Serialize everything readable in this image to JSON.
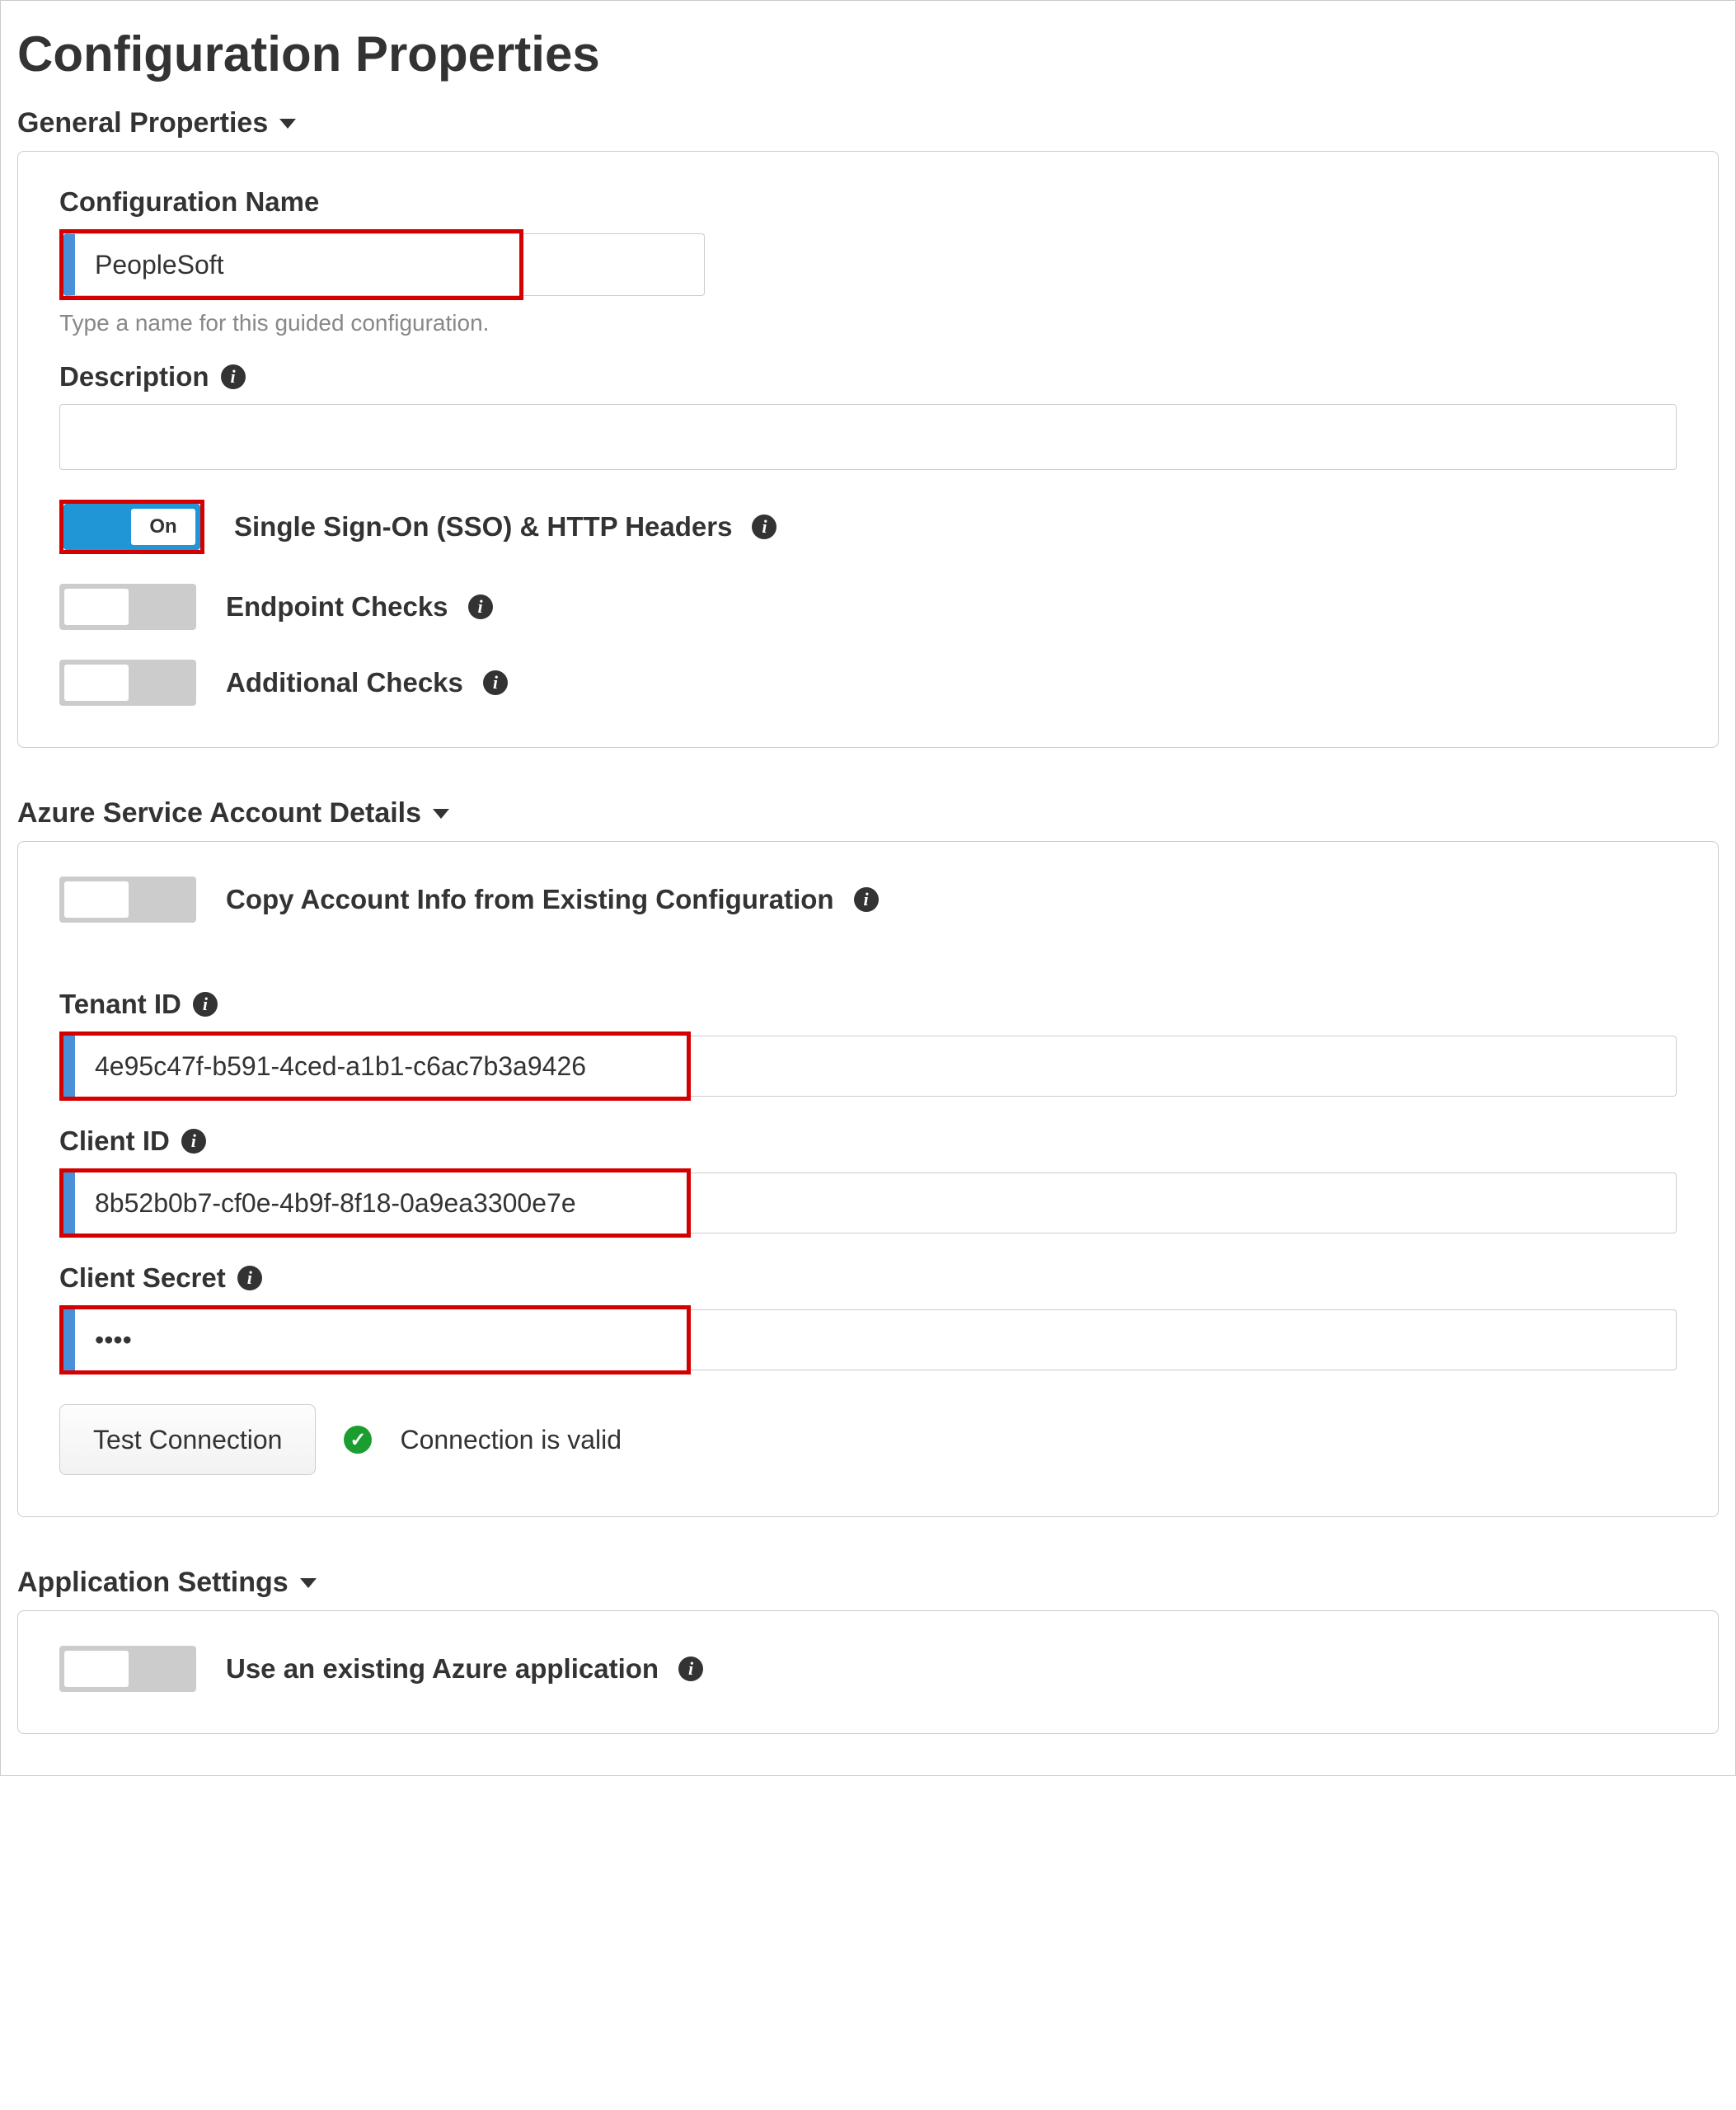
{
  "page": {
    "title": "Configuration Properties"
  },
  "sections": {
    "general": {
      "header": "General Properties",
      "config_name": {
        "label": "Configuration Name",
        "value": "PeopleSoft",
        "help": "Type a name for this guided configuration."
      },
      "description": {
        "label": "Description",
        "value": ""
      },
      "toggles": {
        "sso": {
          "label": "Single Sign-On (SSO) & HTTP Headers",
          "on_text": "On"
        },
        "endpoint": {
          "label": "Endpoint Checks"
        },
        "additional": {
          "label": "Additional Checks"
        }
      }
    },
    "azure": {
      "header": "Azure Service Account Details",
      "copy_toggle": {
        "label": "Copy Account Info from Existing Configuration"
      },
      "tenant": {
        "label": "Tenant ID",
        "value": "4e95c47f-b591-4ced-a1b1-c6ac7b3a9426"
      },
      "client": {
        "label": "Client ID",
        "value": "8b52b0b7-cf0e-4b9f-8f18-0a9ea3300e7e"
      },
      "secret": {
        "label": "Client Secret",
        "value": "••••"
      },
      "test_btn": "Test Connection",
      "status": "Connection is valid"
    },
    "appsettings": {
      "header": "Application Settings",
      "use_existing": {
        "label": "Use an existing Azure application"
      }
    }
  }
}
